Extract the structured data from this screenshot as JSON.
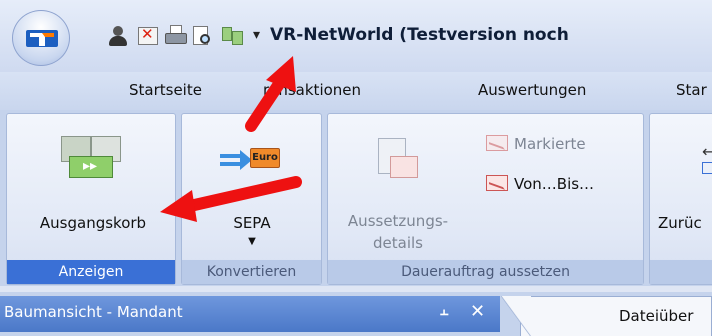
{
  "window": {
    "title": "VR-NetWorld (Testversion noch",
    "quick_access_dropdown": "▾"
  },
  "quick_access": [
    "user-icon",
    "close-window-icon",
    "print-icon",
    "print-preview-icon",
    "outbox-icon"
  ],
  "ribbon_tabs": [
    "Startseite",
    "Transaktionen",
    "Auswertungen",
    "Stammdaten"
  ],
  "ribbon_tabs_visible": [
    "Startseite",
    "ransaktionen",
    "Auswertungen",
    "Star"
  ],
  "groups": {
    "anzeigen": {
      "label": "Anzeigen",
      "buttons": {
        "ausgangskorb": "Ausgangskorb"
      }
    },
    "konvertieren": {
      "label": "Konvertieren",
      "buttons": {
        "sepa": "SEPA",
        "sepa_icon_text": "Euro"
      }
    },
    "dauerauftrag": {
      "label": "Dauerauftrag aussetzen",
      "buttons": {
        "aussetzungsdetails_line1": "Aussetzungs-",
        "aussetzungsdetails_line2": "details",
        "markierte": "Markierte",
        "von_bis": "Von…Bis…"
      }
    },
    "navigation": {
      "buttons": {
        "zurueck": "Zurüc"
      }
    }
  },
  "panes": {
    "tree_title": "Baumansicht - Mandant",
    "pin_glyph": "⫠",
    "close_glyph": "✕",
    "document_tab": "Dateiüber"
  },
  "colors": {
    "active_group_label": "#3a70d6",
    "annotation_arrow": "#ee1111",
    "pane_header": "#4b78c8"
  }
}
